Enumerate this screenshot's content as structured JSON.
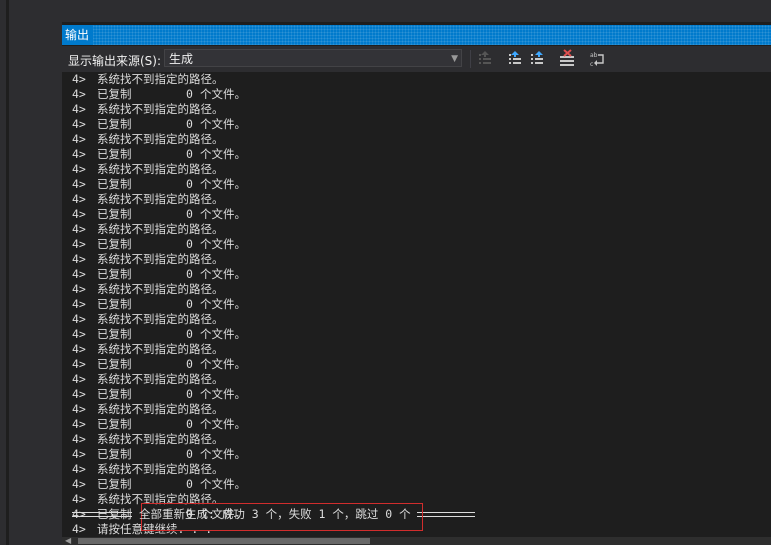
{
  "panel": {
    "title": "输出",
    "source_label": "显示输出来源(S):",
    "source_value": "生成",
    "toolbar_icons": [
      "goto-prev-message-icon",
      "goto-next-message-icon",
      "goto-last-message-icon",
      "clear-all-icon",
      "toggle-word-wrap-icon"
    ]
  },
  "output": {
    "prefix": "4>",
    "not_found_text": "系统找不到指定的路径。",
    "copied_label": "已复制",
    "copied_count": "0",
    "copied_unit": "个文件。",
    "last_line": "请按任意键继续. . .",
    "summary": "全部重新生成: 成功 3 个，失败 1 个，跳过 0 个"
  },
  "colors": {
    "accent": "#007acc",
    "background": "#1e1e1e",
    "text": "#dcdcdc",
    "highlight_border": "#d12d2d"
  }
}
